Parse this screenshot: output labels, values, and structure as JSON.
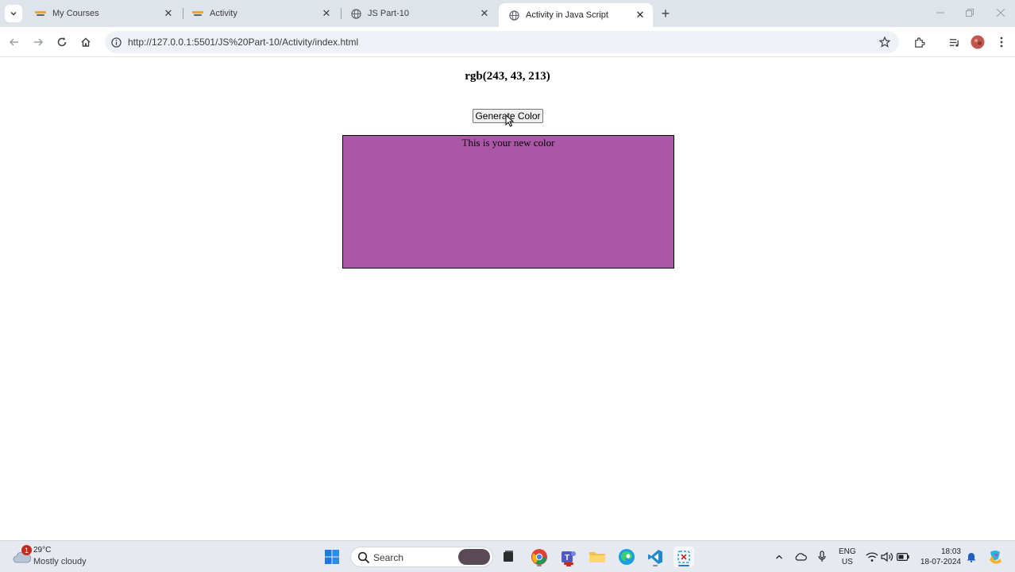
{
  "browser": {
    "tabs": [
      {
        "title": "My Courses",
        "active": false
      },
      {
        "title": "Activity",
        "active": false
      },
      {
        "title": "JS Part-10",
        "active": false
      },
      {
        "title": "Activity in Java Script",
        "active": true
      }
    ],
    "url": "http://127.0.0.1:5501/JS%20Part-10/Activity/index.html"
  },
  "page": {
    "heading": "rgb(243, 43, 213)",
    "button_label": "Generate Color",
    "box_text": "This is your new color",
    "box_color": "#ab57a8"
  },
  "taskbar": {
    "weather_badge": "1",
    "temperature": "29°C",
    "weather_desc": "Mostly cloudy",
    "search_label": "Search",
    "lang_line1": "ENG",
    "lang_line2": "US",
    "time": "18:03",
    "date": "18-07-2024",
    "apps": [
      "windows-start-icon",
      "search",
      "task-view-icon",
      "chrome-icon",
      "teams-icon",
      "file-explorer-icon",
      "edge-icon",
      "vscode-icon",
      "snipping-tool-icon"
    ]
  },
  "colors": {
    "tabstrip_bg": "#dfe3ea",
    "omnibox_bg": "#eef1f6",
    "taskbar_bg": "#e6e9f0"
  }
}
